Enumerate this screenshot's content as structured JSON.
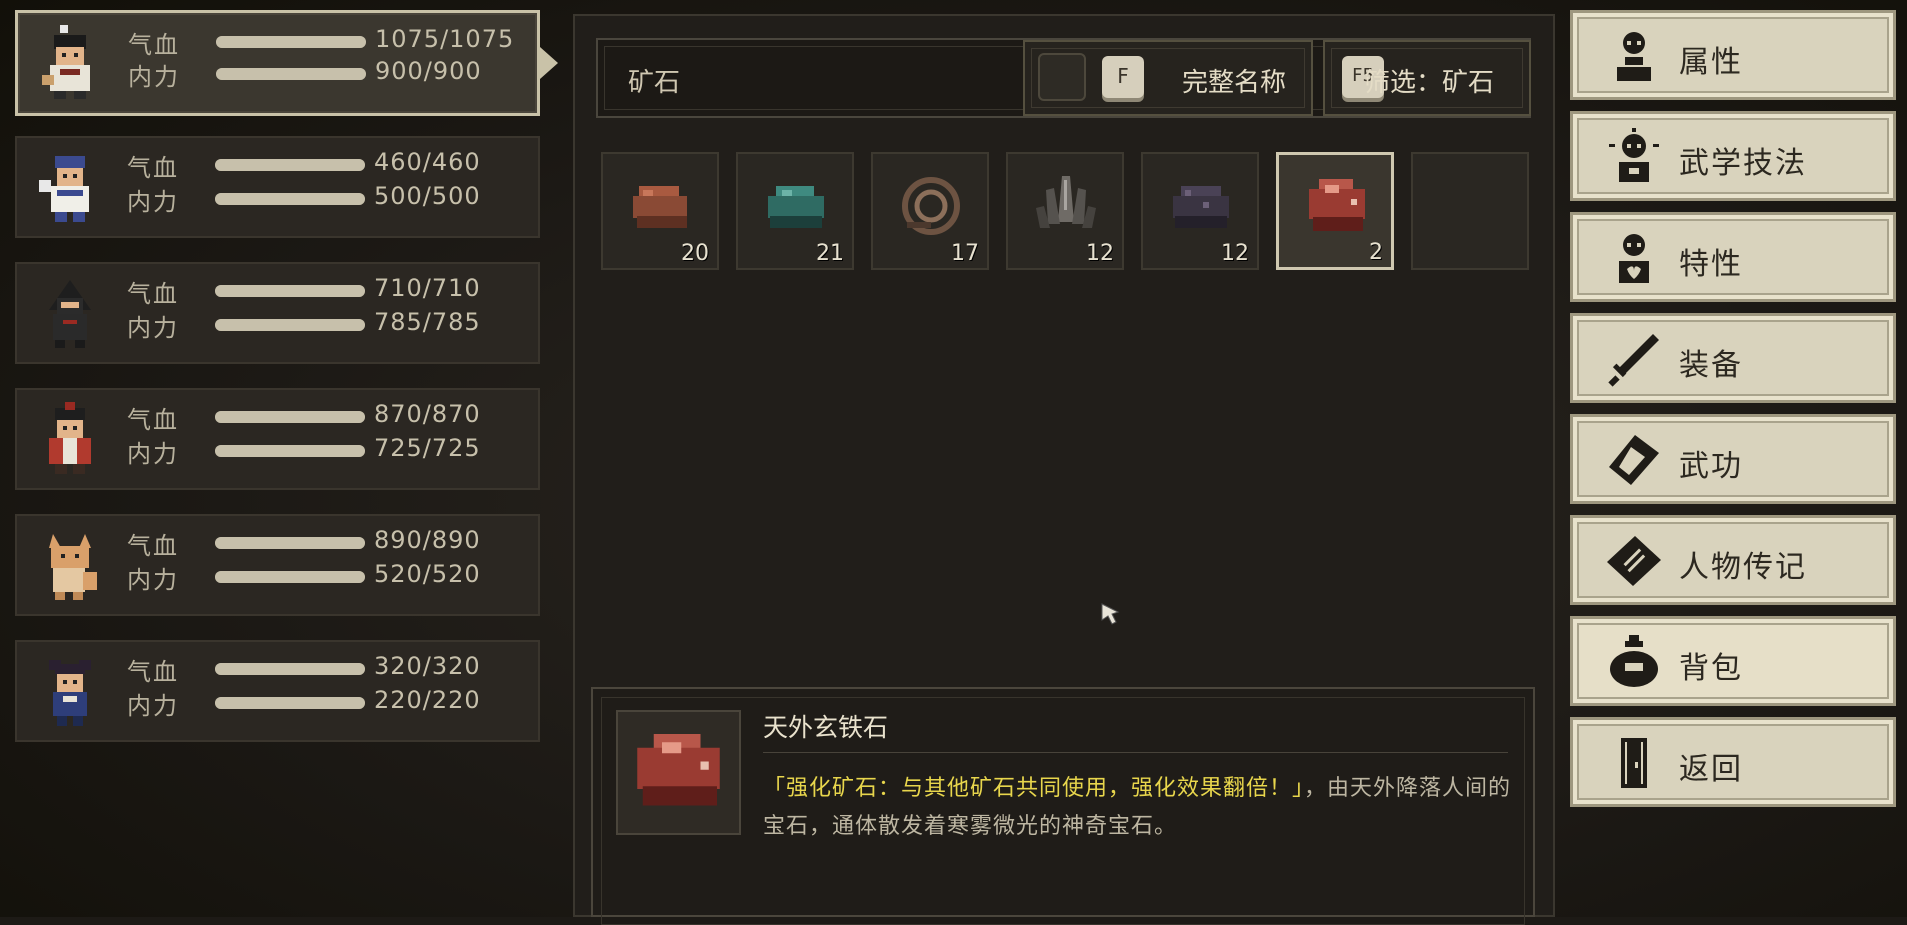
{
  "party": [
    {
      "hp_label": "气血",
      "hp": "1075/1075",
      "hp_frac": 1.0,
      "mp_label": "内力",
      "mp": "900/900",
      "mp_frac": 1.0,
      "selected": true
    },
    {
      "hp_label": "气血",
      "hp": "460/460",
      "hp_frac": 1.0,
      "mp_label": "内力",
      "mp": "500/500",
      "mp_frac": 1.0
    },
    {
      "hp_label": "气血",
      "hp": "710/710",
      "hp_frac": 1.0,
      "mp_label": "内力",
      "mp": "785/785",
      "mp_frac": 1.0
    },
    {
      "hp_label": "气血",
      "hp": "870/870",
      "hp_frac": 1.0,
      "mp_label": "内力",
      "mp": "725/725",
      "mp_frac": 1.0
    },
    {
      "hp_label": "气血",
      "hp": "890/890",
      "hp_frac": 1.0,
      "mp_label": "内力",
      "mp": "520/520",
      "mp_frac": 1.0
    },
    {
      "hp_label": "气血",
      "hp": "320/320",
      "hp_frac": 1.0,
      "mp_label": "内力",
      "mp": "220/220",
      "mp_frac": 1.0
    }
  ],
  "search": {
    "value": "矿石",
    "fullname_key": "F",
    "fullname_label": "完整名称",
    "filter_key": "F5",
    "filter_label": "筛选：矿石"
  },
  "items": [
    {
      "name": "ore-brown",
      "count": "20",
      "color": "#8a4a35"
    },
    {
      "name": "ore-teal",
      "count": "21",
      "color": "#2f6b63"
    },
    {
      "name": "ore-coil",
      "count": "17",
      "color": "#6d5342"
    },
    {
      "name": "ore-crystal",
      "count": "12",
      "color": "#6f6b66"
    },
    {
      "name": "ore-dark",
      "count": "12",
      "color": "#3a3442"
    },
    {
      "name": "ore-red",
      "count": "2",
      "color": "#9a3b32",
      "selected": true
    },
    {
      "name": "empty",
      "count": ""
    }
  ],
  "detail": {
    "name": "天外玄铁石",
    "desc_highlight": "「强化矿石：与其他矿石共同使用，强化效果翻倍！」",
    "desc_rest": "，由天外降落人间的宝石，通体散发着寒雾微光的神奇宝石。"
  },
  "menu": [
    {
      "label": "属性",
      "icon": "person-icon"
    },
    {
      "label": "武学技法",
      "icon": "idea-person-icon"
    },
    {
      "label": "特性",
      "icon": "heart-person-icon"
    },
    {
      "label": "装备",
      "icon": "sword-icon"
    },
    {
      "label": "武功",
      "icon": "scroll-book-icon"
    },
    {
      "label": "人物传记",
      "icon": "biography-book-icon"
    },
    {
      "label": "背包",
      "icon": "bag-icon",
      "active": true
    },
    {
      "label": "返回",
      "icon": "door-icon"
    }
  ]
}
